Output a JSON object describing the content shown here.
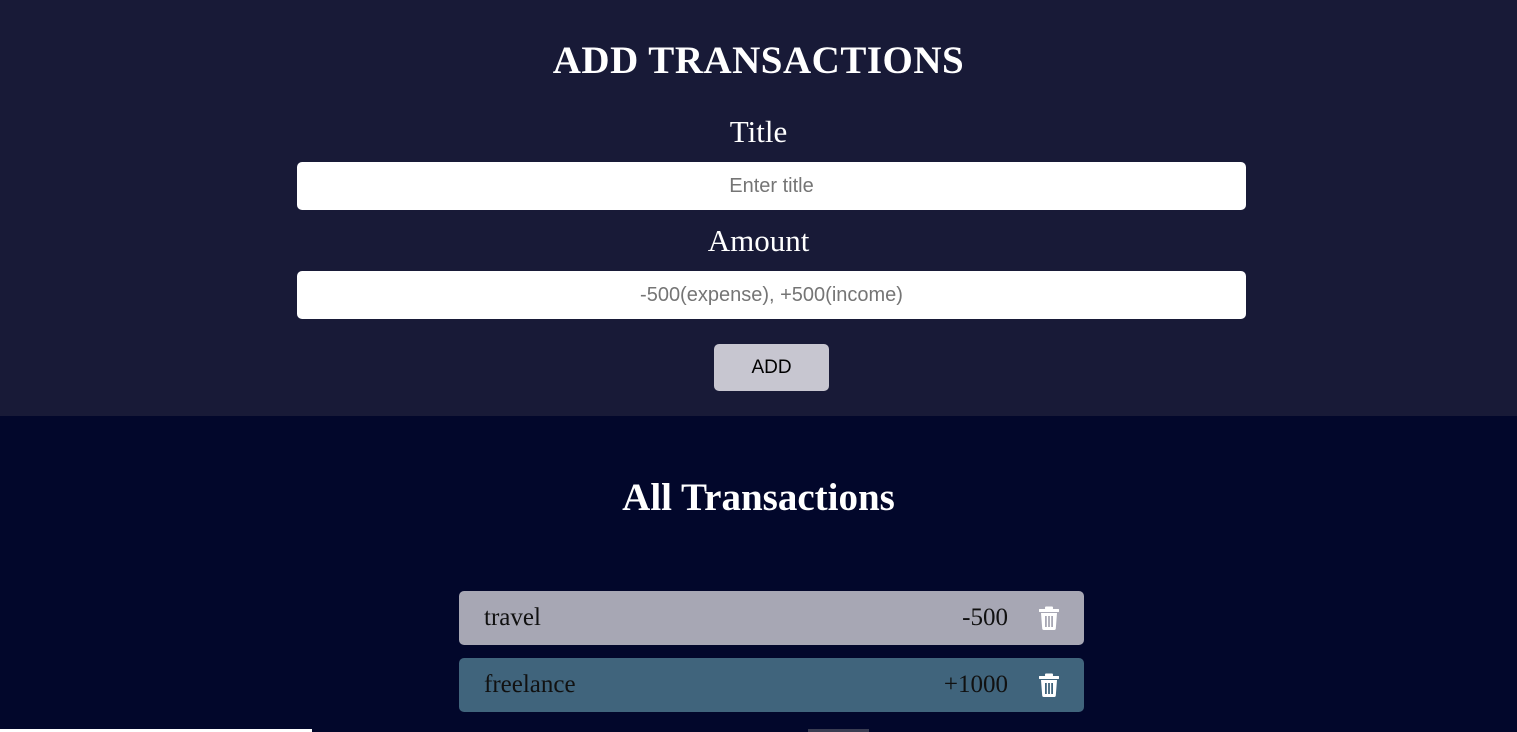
{
  "add_form": {
    "heading": "ADD TRANSACTIONS",
    "title_label": "Title",
    "title_placeholder": "Enter title",
    "title_value": "",
    "amount_label": "Amount",
    "amount_placeholder": "-500(expense), +500(income)",
    "amount_value": "",
    "add_button_label": "ADD"
  },
  "transactions": {
    "heading": "All Transactions",
    "items": [
      {
        "name": "travel",
        "amount": "-500",
        "type": "expense",
        "color": "#a7a7b4",
        "delete_icon": "trash-icon"
      },
      {
        "name": "freelance",
        "amount": "+1000",
        "type": "income",
        "color": "#40647c",
        "delete_icon": "trash-icon"
      }
    ]
  },
  "colors": {
    "form_background": "#181a37",
    "list_background": "#02072b",
    "button_background": "#c7c6d0"
  }
}
